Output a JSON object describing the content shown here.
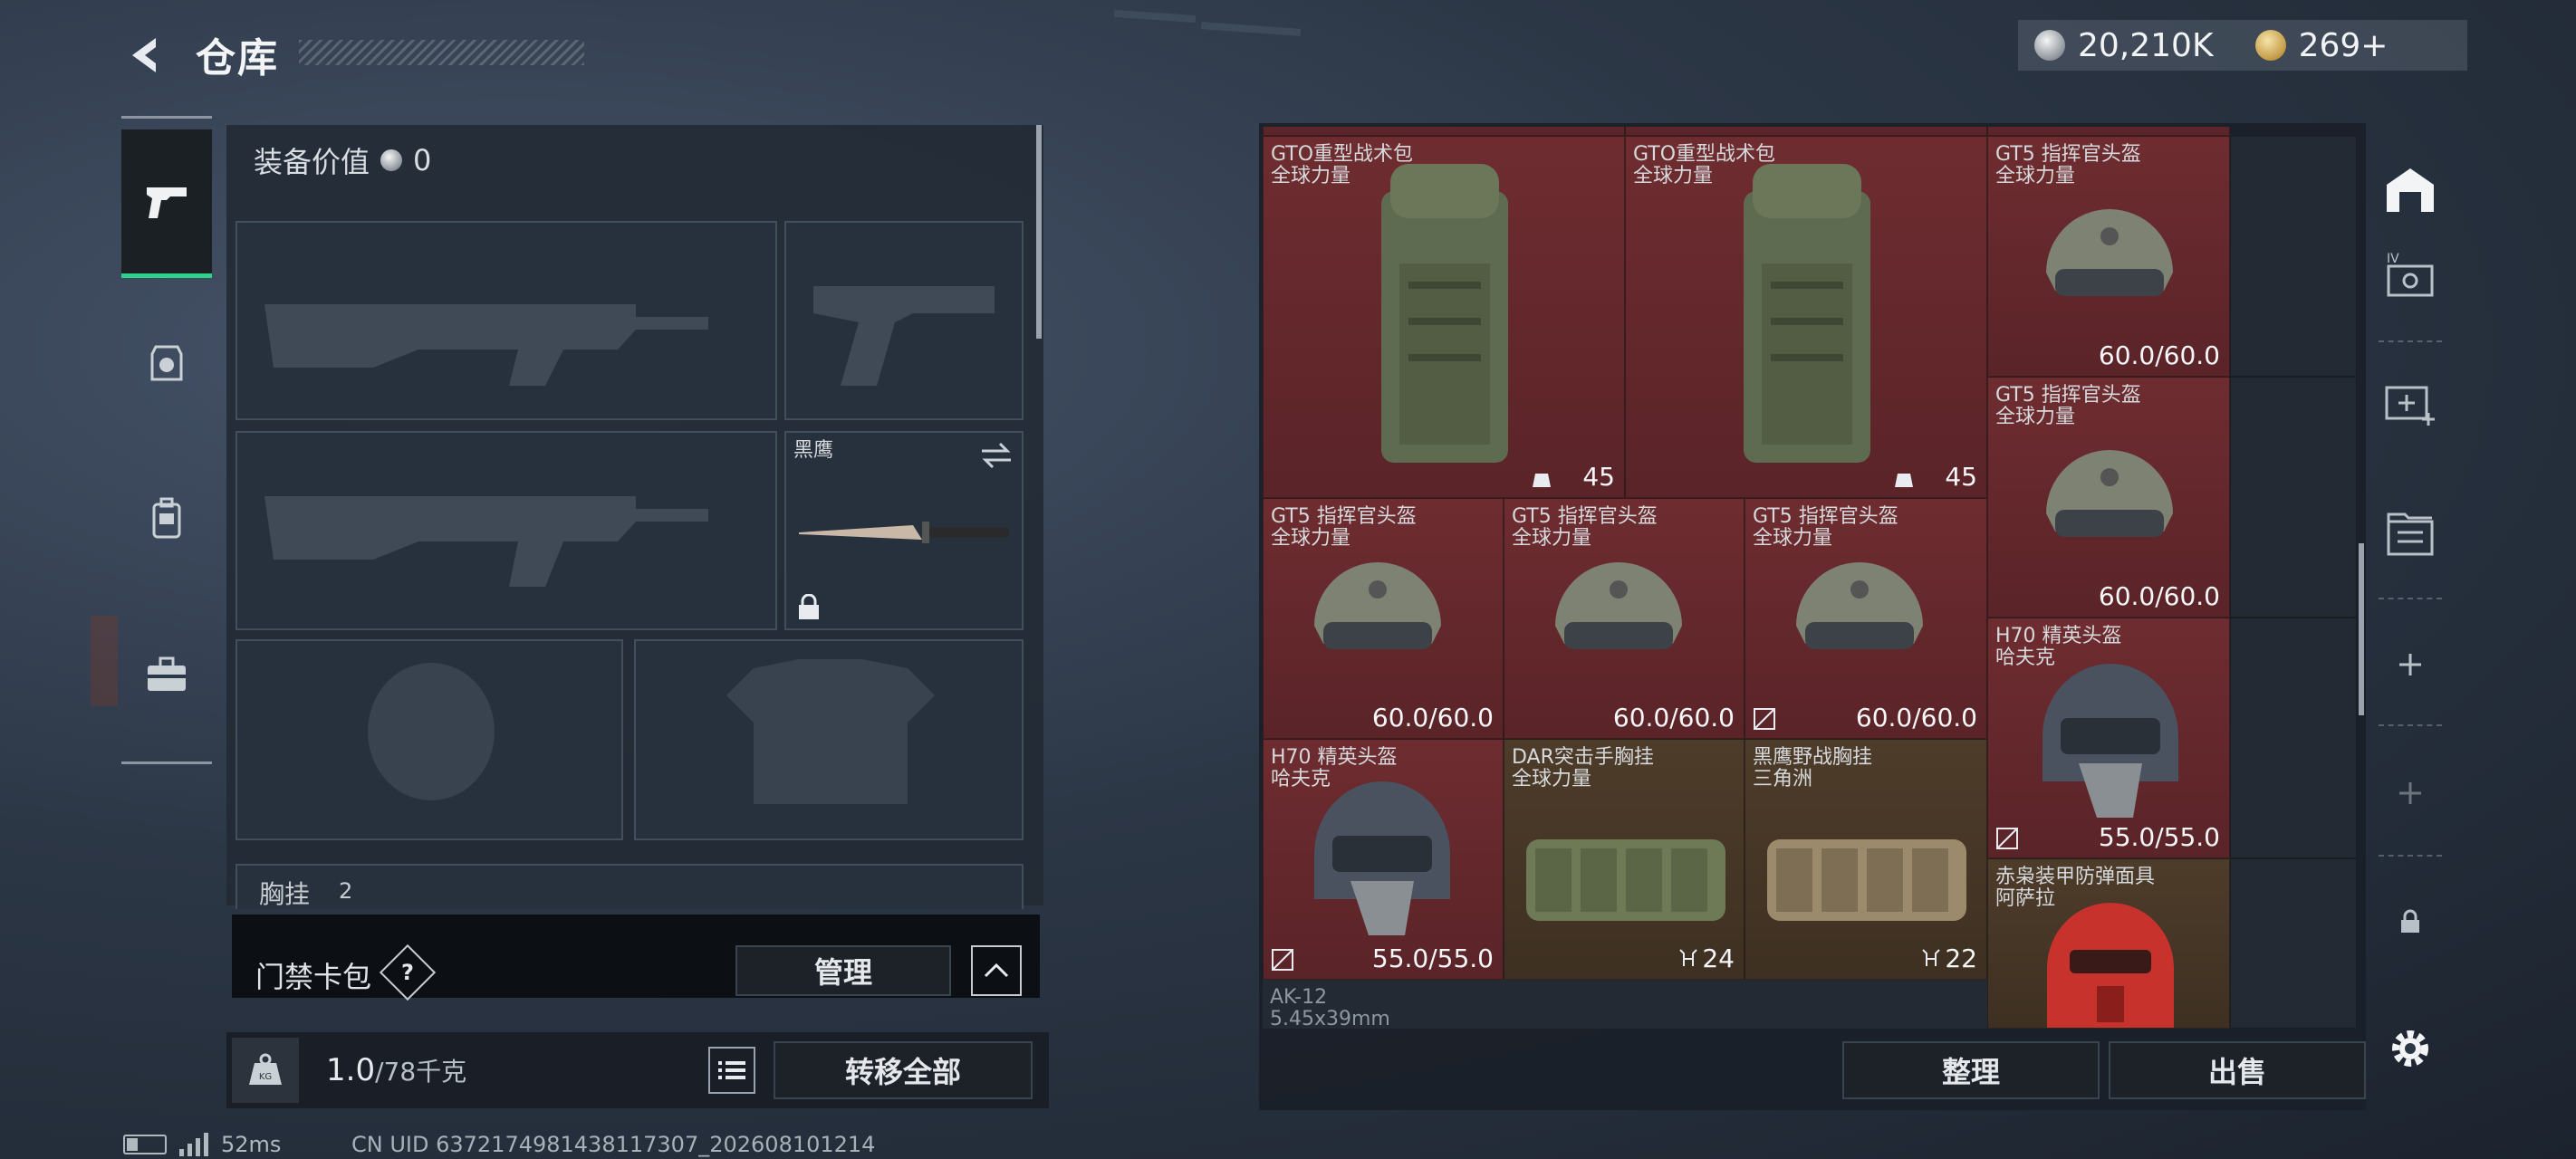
{
  "header": {
    "title": "仓库",
    "currency_silver": "20,210K",
    "currency_gold": "269+"
  },
  "left": {
    "equip_label": "装备价值",
    "equip_value": "0",
    "knife_name": "黑鹰",
    "chest_label": "胸挂",
    "chest_count": "2"
  },
  "access": {
    "label": "门禁卡包",
    "help": "?",
    "manage": "管理"
  },
  "bottom": {
    "weight": "1.0",
    "weight_unit": "/78千克",
    "transfer": "转移全部"
  },
  "status": {
    "ping": "52ms",
    "uid": "CN UID 6372174981438117307_202608101214"
  },
  "storage": {
    "items": [
      {
        "name": "GTO重型战术包",
        "sub": "全球力量",
        "count": "45"
      },
      {
        "name": "GTO重型战术包",
        "sub": "全球力量",
        "count": "45"
      },
      {
        "name": "GT5 指挥官头盔",
        "sub": "全球力量",
        "val": "60.0/60.0"
      },
      {
        "name": "GT5 指挥官头盔",
        "sub": "全球力量",
        "val": "60.0/60.0"
      },
      {
        "name": "GT5 指挥官头盔",
        "sub": "全球力量",
        "val": "60.0/60.0"
      },
      {
        "name": "GT5 指挥官头盔",
        "sub": "全球力量",
        "val": "60.0/60.0"
      },
      {
        "name": "GT5 指挥官头盔",
        "sub": "全球力量",
        "val": "60.0/60.0"
      },
      {
        "name": "H70 精英头盔",
        "sub": "哈夫克",
        "val": "55.0/55.0"
      },
      {
        "name": "H70 精英头盔",
        "sub": "哈夫克",
        "val": "55.0/55.0"
      },
      {
        "name": "DAR突击手胸挂",
        "sub": "全球力量",
        "count": "24"
      },
      {
        "name": "黑鹰野战胸挂",
        "sub": "三角洲",
        "count": "22"
      },
      {
        "name": "赤枭装甲防弹面具",
        "sub": "阿萨拉"
      },
      {
        "name": "AK-12",
        "sub": "5.45x39mm"
      }
    ],
    "sort": "整理",
    "sell": "出售"
  },
  "colors": {
    "accent_green": "#2ed08a",
    "rare_red": "#6e2c30",
    "epic_brown": "#4e3c2a"
  }
}
